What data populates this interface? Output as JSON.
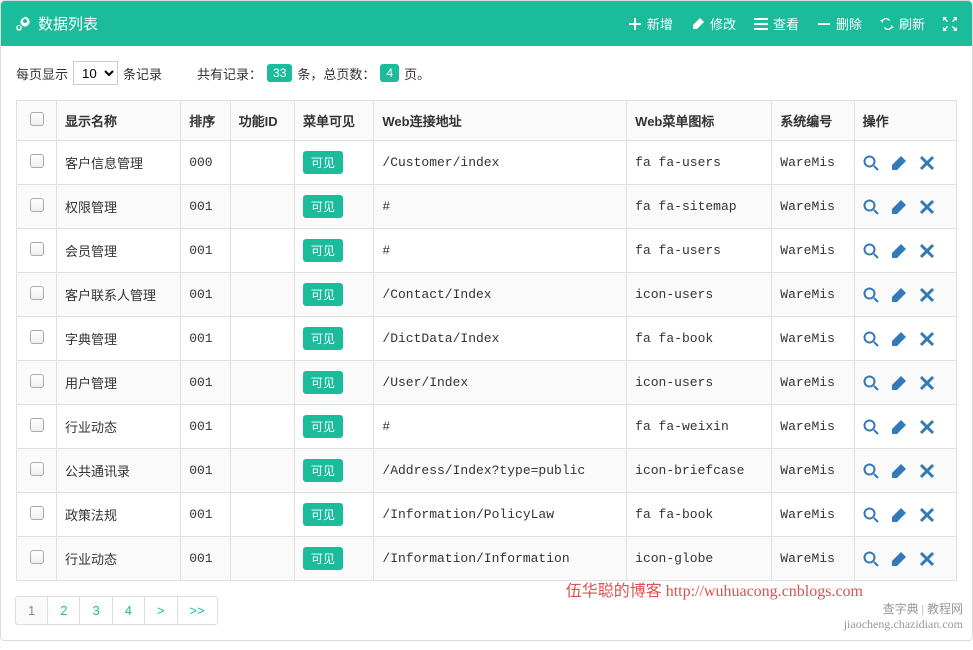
{
  "header": {
    "title": "数据列表",
    "buttons": {
      "add": "新增",
      "edit": "修改",
      "view": "查看",
      "delete": "删除",
      "refresh": "刷新"
    }
  },
  "info": {
    "per_page_prefix": "每页显示",
    "per_page_value": "10",
    "per_page_suffix": "条记录",
    "total_prefix": "共有记录：",
    "total_records": "33",
    "total_mid": "条，总页数：",
    "total_pages": "4",
    "total_suffix": "页。"
  },
  "columns": {
    "name": "显示名称",
    "sort": "排序",
    "func_id": "功能ID",
    "menu_visible": "菜单可见",
    "web_url": "Web连接地址",
    "web_icon": "Web菜单图标",
    "sys_no": "系统编号",
    "ops": "操作"
  },
  "visible_label": "可见",
  "rows": [
    {
      "name": "客户信息管理",
      "sort": "000",
      "func_id": "",
      "url": "/Customer/index",
      "icon": "fa fa-users",
      "sys": "WareMis"
    },
    {
      "name": "权限管理",
      "sort": "001",
      "func_id": "",
      "url": "#",
      "icon": "fa fa-sitemap",
      "sys": "WareMis"
    },
    {
      "name": "会员管理",
      "sort": "001",
      "func_id": "",
      "url": "#",
      "icon": "fa fa-users",
      "sys": "WareMis"
    },
    {
      "name": "客户联系人管理",
      "sort": "001",
      "func_id": "",
      "url": "/Contact/Index",
      "icon": "icon-users",
      "sys": "WareMis"
    },
    {
      "name": "字典管理",
      "sort": "001",
      "func_id": "",
      "url": "/DictData/Index",
      "icon": "fa fa-book",
      "sys": "WareMis"
    },
    {
      "name": "用户管理",
      "sort": "001",
      "func_id": "",
      "url": "/User/Index",
      "icon": "icon-users",
      "sys": "WareMis"
    },
    {
      "name": "行业动态",
      "sort": "001",
      "func_id": "",
      "url": "#",
      "icon": "fa fa-weixin",
      "sys": "WareMis"
    },
    {
      "name": "公共通讯录",
      "sort": "001",
      "func_id": "",
      "url": "/Address/Index?type=public",
      "icon": "icon-briefcase",
      "sys": "WareMis"
    },
    {
      "name": "政策法规",
      "sort": "001",
      "func_id": "",
      "url": "/Information/PolicyLaw",
      "icon": "fa fa-book",
      "sys": "WareMis"
    },
    {
      "name": "行业动态",
      "sort": "001",
      "func_id": "",
      "url": "/Information/Information",
      "icon": "icon-globe",
      "sys": "WareMis"
    }
  ],
  "pagination": {
    "pages": [
      "1",
      "2",
      "3",
      "4"
    ],
    "active": "1",
    "next": ">",
    "last": ">>"
  },
  "credit": "伍华聪的博客 http://wuhuacong.cnblogs.com",
  "watermark_line1": "查字典 | 教程网",
  "watermark_line2": "jiaocheng.chazidian.com",
  "colors": {
    "accent": "#1abc9c",
    "action_blue": "#337ab7",
    "credit_red": "#d9534f"
  }
}
